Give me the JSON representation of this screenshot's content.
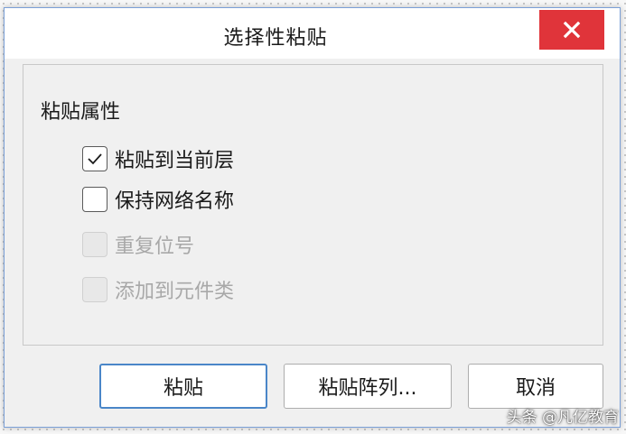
{
  "dialog": {
    "title": "选择性粘贴",
    "close_icon": "close-icon"
  },
  "group": {
    "label": "粘贴属性",
    "options": [
      {
        "label": "粘贴到当前层",
        "checked": true,
        "enabled": true
      },
      {
        "label": "保持网络名称",
        "checked": false,
        "enabled": true
      },
      {
        "label": "重复位号",
        "checked": false,
        "enabled": false
      },
      {
        "label": "添加到元件类",
        "checked": false,
        "enabled": false
      }
    ]
  },
  "buttons": {
    "paste": "粘贴",
    "paste_array": "粘贴阵列...",
    "cancel": "取消"
  },
  "watermark": "头条 @凡亿教育",
  "colors": {
    "close_bg": "#e0343a",
    "default_border": "#4a86c8",
    "dialog_bg": "#f0f0f0"
  }
}
